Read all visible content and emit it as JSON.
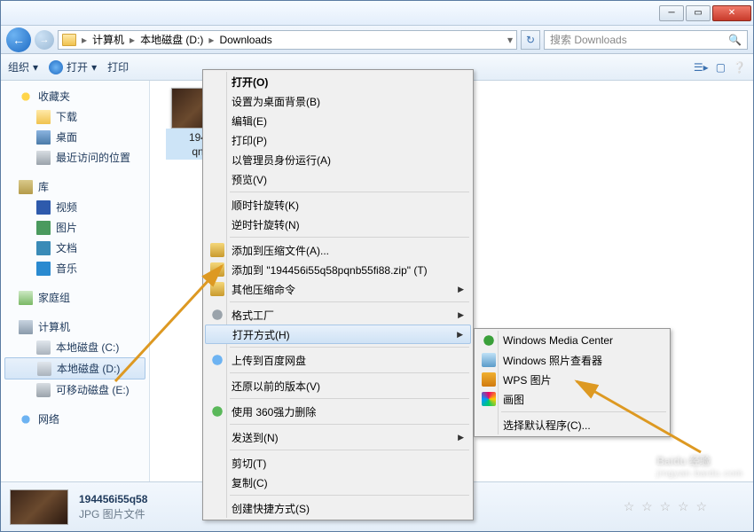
{
  "breadcrumb": {
    "root": "计算机",
    "drive": "本地磁盘 (D:)",
    "folder": "Downloads"
  },
  "search": {
    "placeholder": "搜索 Downloads"
  },
  "toolbar": {
    "organize": "组织",
    "open": "打开",
    "print": "打印"
  },
  "sidebar": {
    "favorites": "收藏夹",
    "fav_items": [
      "下载",
      "桌面",
      "最近访问的位置"
    ],
    "libraries": "库",
    "lib_items": [
      "视频",
      "图片",
      "文档",
      "音乐"
    ],
    "homegroup": "家庭组",
    "computer": "计算机",
    "drives": [
      "本地磁盘 (C:)",
      "本地磁盘 (D:)",
      "可移动磁盘 (E:)"
    ],
    "network": "网络"
  },
  "file": {
    "name_line1": "194",
    "name_line2": "qn"
  },
  "ctx": {
    "items": [
      {
        "label": "打开(O)",
        "bold": true
      },
      {
        "label": "设置为桌面背景(B)"
      },
      {
        "label": "编辑(E)"
      },
      {
        "label": "打印(P)"
      },
      {
        "label": "以管理员身份运行(A)"
      },
      {
        "label": "预览(V)"
      },
      {
        "sep": true
      },
      {
        "label": "顺时针旋转(K)"
      },
      {
        "label": "逆时针旋转(N)"
      },
      {
        "sep": true
      },
      {
        "label": "添加到压缩文件(A)...",
        "icon": "zip"
      },
      {
        "label": "添加到 \"194456i55q58pqnb55fi88.zip\" (T)",
        "icon": "zip"
      },
      {
        "label": "其他压缩命令",
        "icon": "zip",
        "sub": true
      },
      {
        "sep": true
      },
      {
        "label": "格式工厂",
        "icon": "gear",
        "sub": true
      },
      {
        "label": "打开方式(H)",
        "sub": true,
        "highlight": true
      },
      {
        "sep": true
      },
      {
        "label": "上传到百度网盘",
        "icon": "globe"
      },
      {
        "sep": true
      },
      {
        "label": "还原以前的版本(V)"
      },
      {
        "sep": true
      },
      {
        "label": "使用 360强力删除",
        "icon": "d360"
      },
      {
        "sep": true
      },
      {
        "label": "发送到(N)",
        "sub": true
      },
      {
        "sep": true
      },
      {
        "label": "剪切(T)"
      },
      {
        "label": "复制(C)"
      },
      {
        "sep": true
      },
      {
        "label": "创建快捷方式(S)"
      }
    ]
  },
  "submenu": {
    "items": [
      {
        "label": "Windows Media Center",
        "icon": "wmc"
      },
      {
        "label": "Windows 照片查看器",
        "icon": "viewer"
      },
      {
        "label": "WPS 图片",
        "icon": "wps"
      },
      {
        "label": "画图",
        "icon": "paint"
      }
    ],
    "choose_default": "选择默认程序(C)..."
  },
  "details": {
    "filename": "194456i55q58",
    "type": "JPG 图片文件"
  },
  "watermark": {
    "main": "Baidu 经验",
    "sub": "jingyan.baidu.com"
  }
}
